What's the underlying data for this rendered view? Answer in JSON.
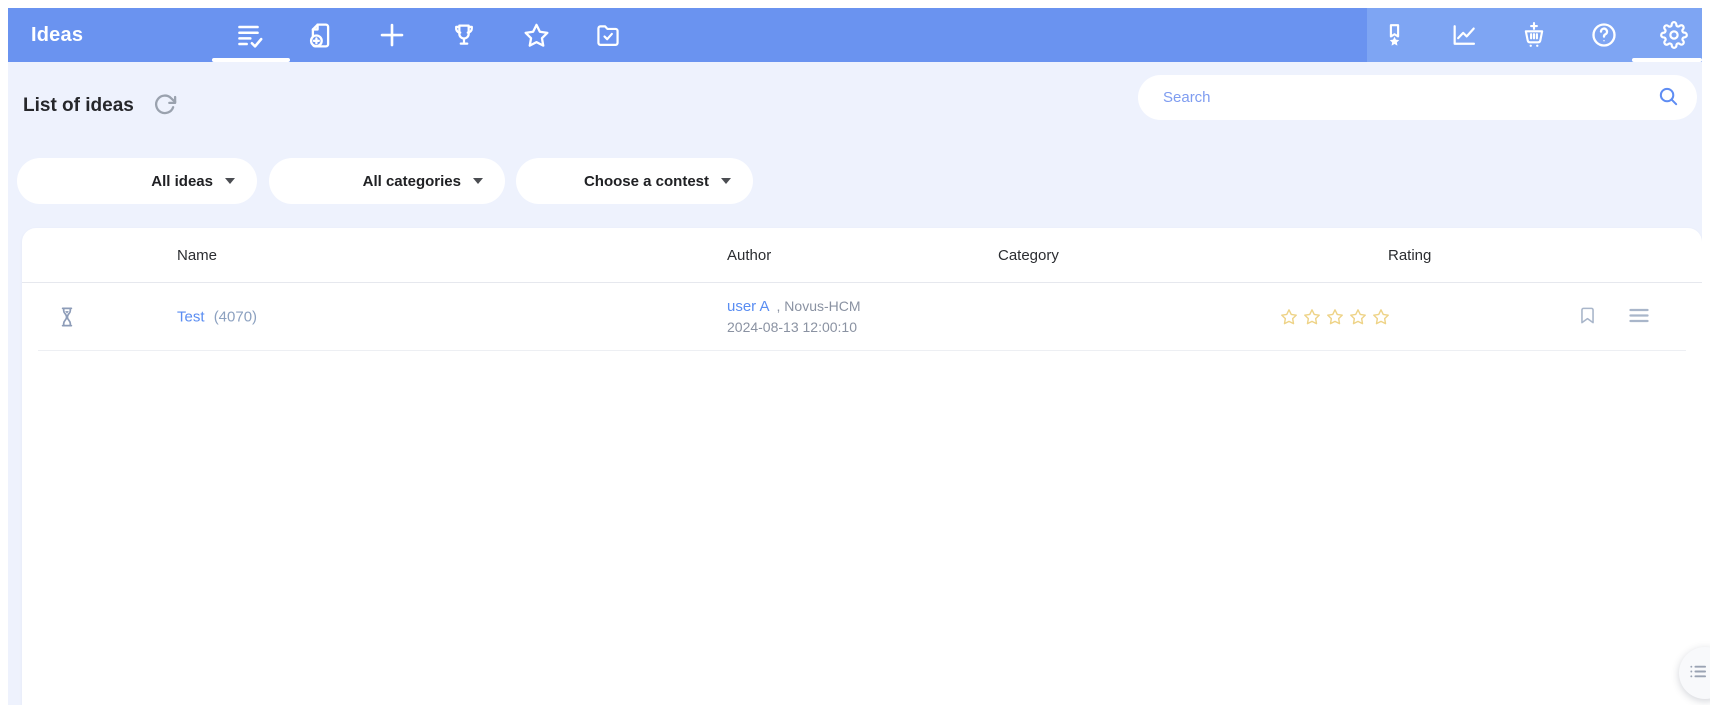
{
  "app": {
    "title": "Ideas"
  },
  "nav": {
    "left": [
      {
        "name": "list-of-ideas",
        "active": true
      },
      {
        "name": "add-document",
        "active": false
      },
      {
        "name": "create-idea",
        "active": false
      },
      {
        "name": "contests",
        "active": false
      },
      {
        "name": "favorites",
        "active": false
      },
      {
        "name": "idea-folder",
        "active": false
      }
    ],
    "right": [
      {
        "name": "achievements",
        "active": false
      },
      {
        "name": "statistics",
        "active": false
      },
      {
        "name": "idea-market",
        "active": false
      },
      {
        "name": "help",
        "active": false
      },
      {
        "name": "settings",
        "active": true
      }
    ]
  },
  "toolbar": {
    "page_title": "List of ideas",
    "search_placeholder": "Search"
  },
  "filters": {
    "ideas_label": "All ideas",
    "categories_label": "All categories",
    "contest_label": "Choose a contest"
  },
  "table": {
    "columns": {
      "name": "Name",
      "author": "Author",
      "category": "Category",
      "rating": "Rating"
    },
    "rows": [
      {
        "status_icon": "hourglass-pending",
        "name": "Test",
        "count": "(4070)",
        "author": "user A",
        "author_company": ", Novus-HCM",
        "date": "2024-08-13 12:00:10",
        "category": "",
        "rating_value": 0,
        "rating_max": 5
      }
    ]
  },
  "colors": {
    "header_bg": "#6a93f0",
    "header_right_bg": "#7ea5f3",
    "page_bg": "#eef2fd",
    "link_blue": "#5a8df2",
    "muted_text": "#8a92a2",
    "star_gold": "#eed387",
    "row_icon_gray": "#a9b6ca"
  }
}
